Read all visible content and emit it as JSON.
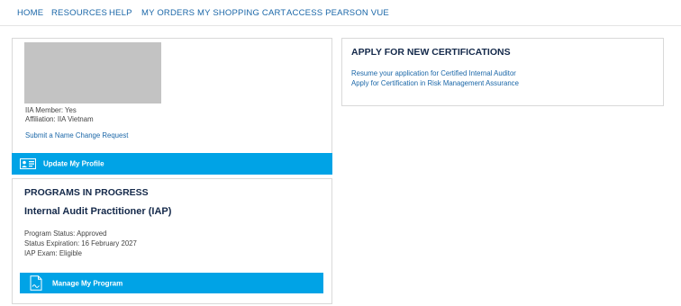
{
  "nav": {
    "items": [
      "HOME",
      "RESOURCES",
      "HELP",
      "MY ORDERS",
      "MY SHOPPING CART",
      "ACCESS PEARSON VUE"
    ]
  },
  "profile": {
    "member_text": "IIA Member: Yes",
    "affiliation_text": "Affiliation: IIA Vietnam",
    "name_change_link": "Submit a Name Change Request",
    "update_button": "Update My Profile",
    "update_icon": "profile-card-icon"
  },
  "programs": {
    "heading": "PROGRAMS IN PROGRESS",
    "program_title": "Internal Audit Practitioner (IAP)",
    "status": "Program Status: Approved",
    "expiration": "Status Expiration: 16 February 2027",
    "exam": "IAP Exam: Eligible",
    "manage_button": "Manage My Program",
    "manage_icon": "document-signature-icon"
  },
  "apply": {
    "heading": "APPLY FOR NEW CERTIFICATIONS",
    "links": [
      "Resume your application for Certified Internal Auditor",
      "Apply for Certification in Risk Management Assurance"
    ]
  },
  "colors": {
    "link": "#1b67a8",
    "button": "#00a3e6",
    "heading": "#14294a"
  }
}
